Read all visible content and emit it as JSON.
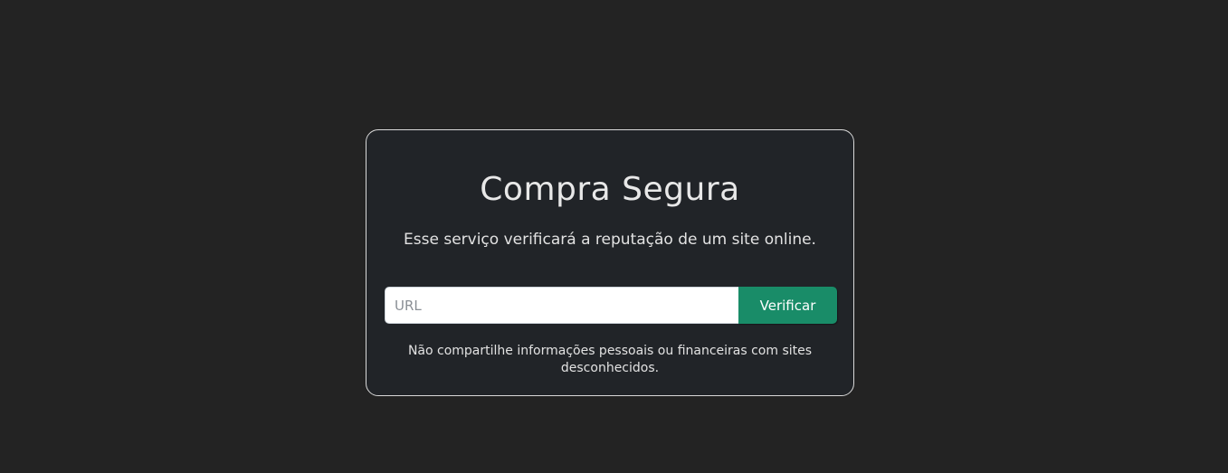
{
  "card": {
    "title": "Compra Segura",
    "subtitle": "Esse serviço verificará a reputação de um site online.",
    "search": {
      "placeholder": "URL",
      "value": "",
      "button_label": "Verificar"
    },
    "footnote": "Não compartilhe informações pessoais ou financeiras com sites desconhecidos."
  },
  "colors": {
    "page_background": "#232323",
    "card_background": "#212428",
    "card_border": "#d9d9d9",
    "button_background": "#198c68",
    "text": "#e6e6e6"
  }
}
